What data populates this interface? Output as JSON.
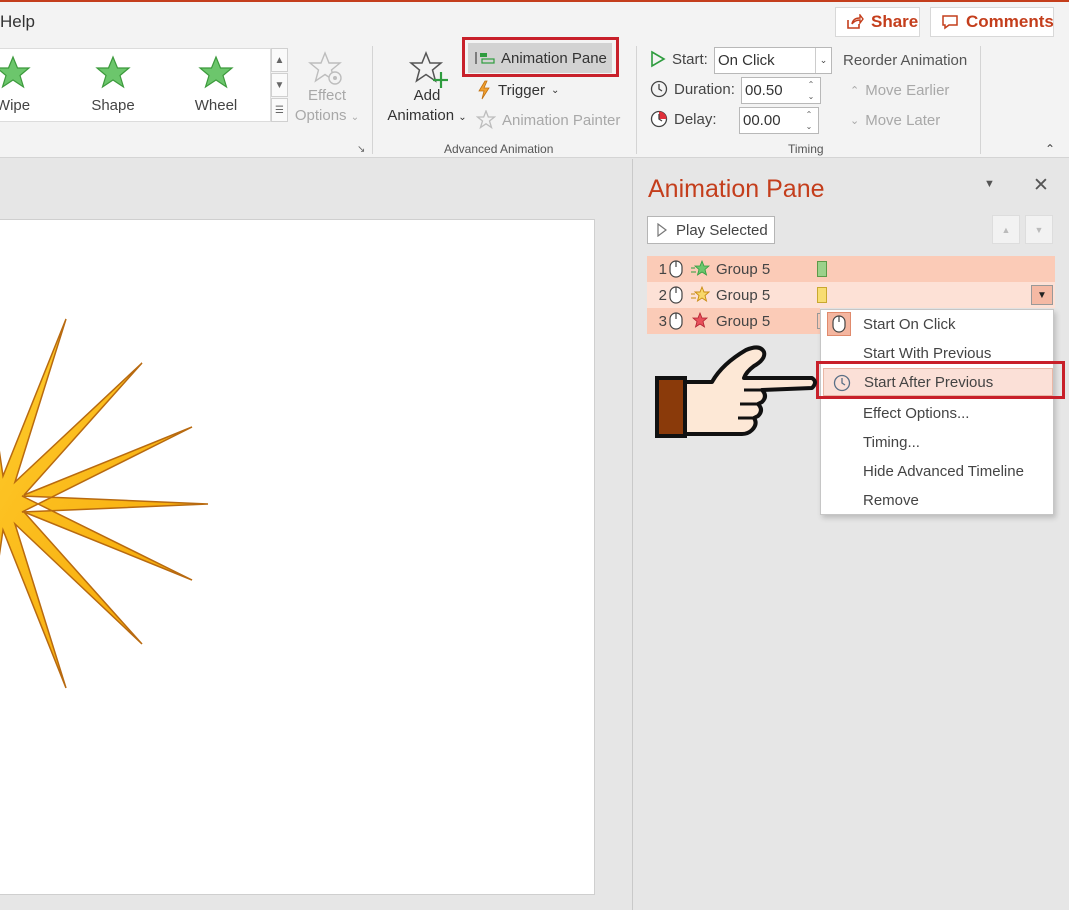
{
  "colors": {
    "accent": "#c43e1c",
    "highlight_border": "#c8202a",
    "row_fill": "#fbcbb7",
    "row_selected": "#fde1d6",
    "menu_hover": "#fbe0d7"
  },
  "menu": {
    "help": "Help"
  },
  "top_buttons": {
    "share": "Share",
    "comments": "Comments"
  },
  "ribbon": {
    "gallery": [
      {
        "label": "Wipe",
        "icon": "star-icon"
      },
      {
        "label": "Shape",
        "icon": "star-icon"
      },
      {
        "label": "Wheel",
        "icon": "star-icon"
      }
    ],
    "effect_options": {
      "line1": "Effect",
      "line2": "Options"
    },
    "add_animation": {
      "line1": "Add",
      "line2": "Animation"
    },
    "advanced": {
      "animation_pane": "Animation Pane",
      "trigger": "Trigger",
      "animation_painter": "Animation Painter",
      "group_label": "Advanced Animation"
    },
    "timing": {
      "start_label": "Start:",
      "start_value": "On Click",
      "duration_label": "Duration:",
      "duration_value": "00.50",
      "delay_label": "Delay:",
      "delay_value": "00.00",
      "group_label": "Timing",
      "reorder_title": "Reorder Animation",
      "move_earlier": "Move Earlier",
      "move_later": "Move Later"
    }
  },
  "pane": {
    "title": "Animation Pane",
    "play_selected": "Play Selected",
    "rows": [
      {
        "num": "1",
        "label": "Group 5",
        "bar_color": "#9bd18a"
      },
      {
        "num": "2",
        "label": "Group 5",
        "bar_color": "#f8dd72"
      },
      {
        "num": "3",
        "label": "Group 5",
        "bar_color": "#f4a98c"
      }
    ]
  },
  "context_menu": {
    "items": [
      {
        "label": "Start On Click"
      },
      {
        "label": "Start With Previous"
      },
      {
        "label": "Start After Previous"
      },
      {
        "label": "Effect Options..."
      },
      {
        "label": "Timing..."
      },
      {
        "label": "Hide Advanced Timeline"
      },
      {
        "label": "Remove"
      }
    ]
  }
}
